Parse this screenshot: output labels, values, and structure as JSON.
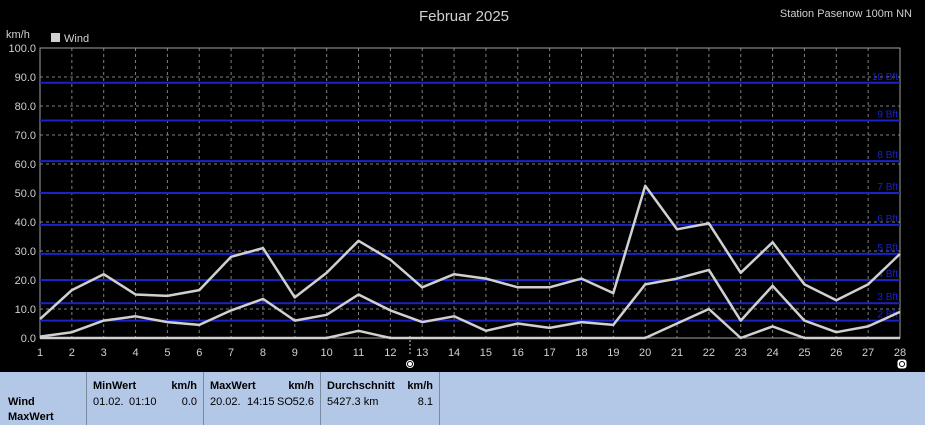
{
  "title": "Februar 2025",
  "station": "Station Pasenow 100m NN",
  "chart_data": {
    "type": "line",
    "title": "Februar 2025",
    "ylabel": "km/h",
    "ylim": [
      0,
      100
    ],
    "yticks": [
      "0.0",
      "10.0",
      "20.0",
      "30.0",
      "40.0",
      "50.0",
      "60.0",
      "70.0",
      "80.0",
      "90.0",
      "100.0"
    ],
    "x": [
      1,
      2,
      3,
      4,
      5,
      6,
      7,
      8,
      9,
      10,
      11,
      12,
      13,
      14,
      15,
      16,
      17,
      18,
      19,
      20,
      21,
      22,
      23,
      24,
      25,
      26,
      27,
      28
    ],
    "legend": [
      "Wind"
    ],
    "series": [
      {
        "name": "Wind",
        "values": [
          6.5,
          16.5,
          22,
          15,
          14.5,
          16.5,
          28,
          31,
          14,
          22.5,
          33.5,
          27,
          17.5,
          22,
          20.5,
          17.5,
          17.5,
          20.5,
          15.5,
          52.5,
          37.5,
          39.5,
          22.5,
          33,
          18.5,
          13,
          18.5,
          29
        ],
        "color": "#d0d0d0"
      },
      {
        "values": [
          0.5,
          2,
          6,
          7.5,
          5.5,
          4.5,
          9.5,
          13.5,
          6,
          8,
          15,
          9.5,
          5.5,
          7.5,
          2.5,
          5,
          3.5,
          5.5,
          4.5,
          18.5,
          20.5,
          23.5,
          6,
          18,
          6,
          2,
          4,
          9
        ],
        "color": "#d0d0d0"
      },
      {
        "values": [
          0,
          0,
          0,
          0,
          0,
          0,
          0,
          0,
          0,
          0,
          2.5,
          0,
          0,
          0,
          0,
          0,
          0,
          0,
          0,
          0,
          5,
          10,
          0,
          4,
          0,
          0,
          0,
          0
        ],
        "color": "#d0d0d0"
      }
    ],
    "beaufort_lines": [
      {
        "value": 88,
        "label": "10 Bft"
      },
      {
        "value": 75,
        "label": "9 Bft"
      },
      {
        "value": 61,
        "label": "8 Bft"
      },
      {
        "value": 50,
        "label": "7 Bft"
      },
      {
        "value": 39,
        "label": "6 Bft"
      },
      {
        "value": 29,
        "label": "5 Bft"
      },
      {
        "value": 20,
        "label": "4 Bft"
      },
      {
        "value": 12,
        "label": "3 Bft"
      },
      {
        "value": 6,
        "label": "2 Bft"
      }
    ],
    "grid": true
  },
  "stats": {
    "row_labels": [
      "Wind",
      "MaxWert"
    ],
    "min": {
      "header": "MinWert",
      "unit": "km/h",
      "date": "01.02.",
      "time": "01:10",
      "value": "0.0"
    },
    "max": {
      "header": "MaxWert",
      "unit": "km/h",
      "date": "20.02.",
      "time": "14:15",
      "dir": "SO",
      "value": "52.6"
    },
    "avg": {
      "header": "Durchschnitt",
      "unit": "km/h",
      "distance": "5427.3 km",
      "value": "8.1"
    }
  },
  "colors": {
    "background": "#000000",
    "beaufort": "#1a22c8",
    "grid": "#808080",
    "line": "#d0d0d0",
    "panel": "#b3c7e6"
  }
}
